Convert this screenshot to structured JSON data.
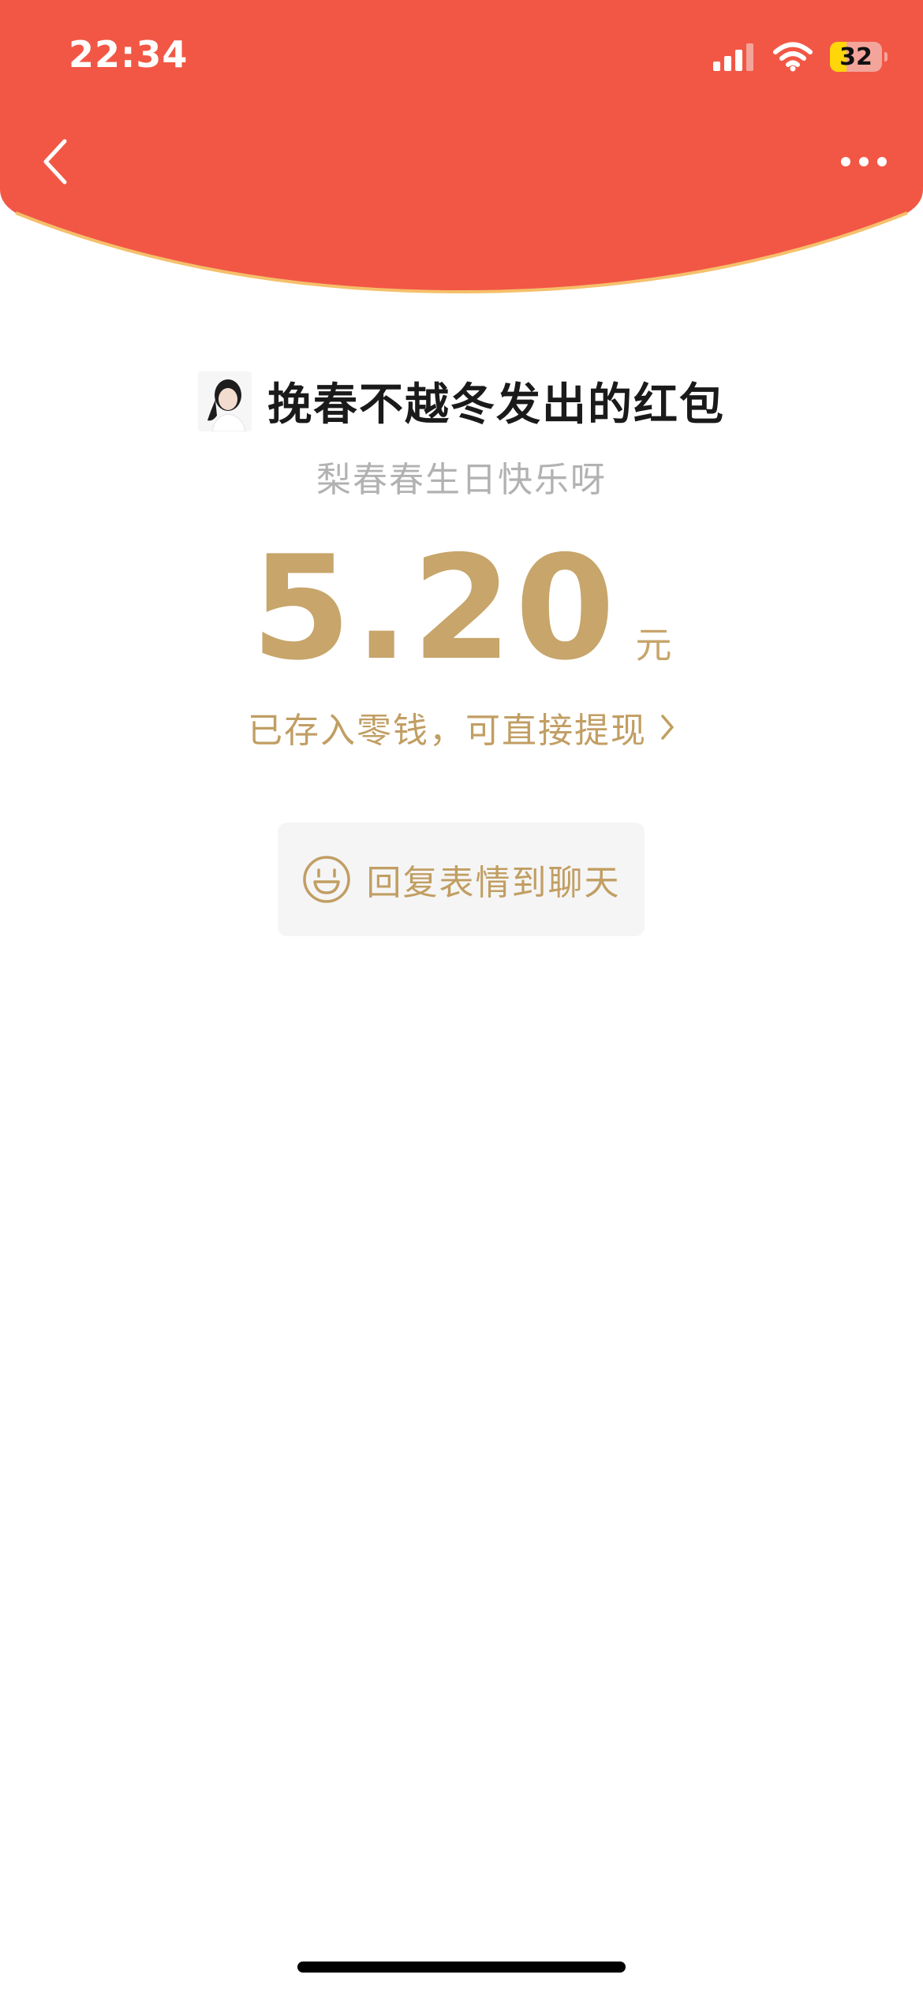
{
  "status_bar": {
    "time": "22:34",
    "battery_level": "32",
    "icons": [
      "signal-icon",
      "wifi-icon",
      "battery-icon"
    ]
  },
  "nav": {
    "back_icon": "chevron-left-icon",
    "more_icon": "more-dots-icon"
  },
  "packet": {
    "sender_title": "挽春不越冬发出的红包",
    "greeting": "梨春春生日快乐呀",
    "amount": "5.20",
    "currency": "元",
    "saved_text": "已存入零钱，可直接提现",
    "reply_label": "回复表情到聊天",
    "reply_icon": "smiley-icon"
  },
  "colors": {
    "header_red": "#F25745",
    "gold": "#C7A56B",
    "arc_border": "#F5C06B",
    "grey_text": "#B2B2B2",
    "button_bg": "#F5F5F5"
  }
}
